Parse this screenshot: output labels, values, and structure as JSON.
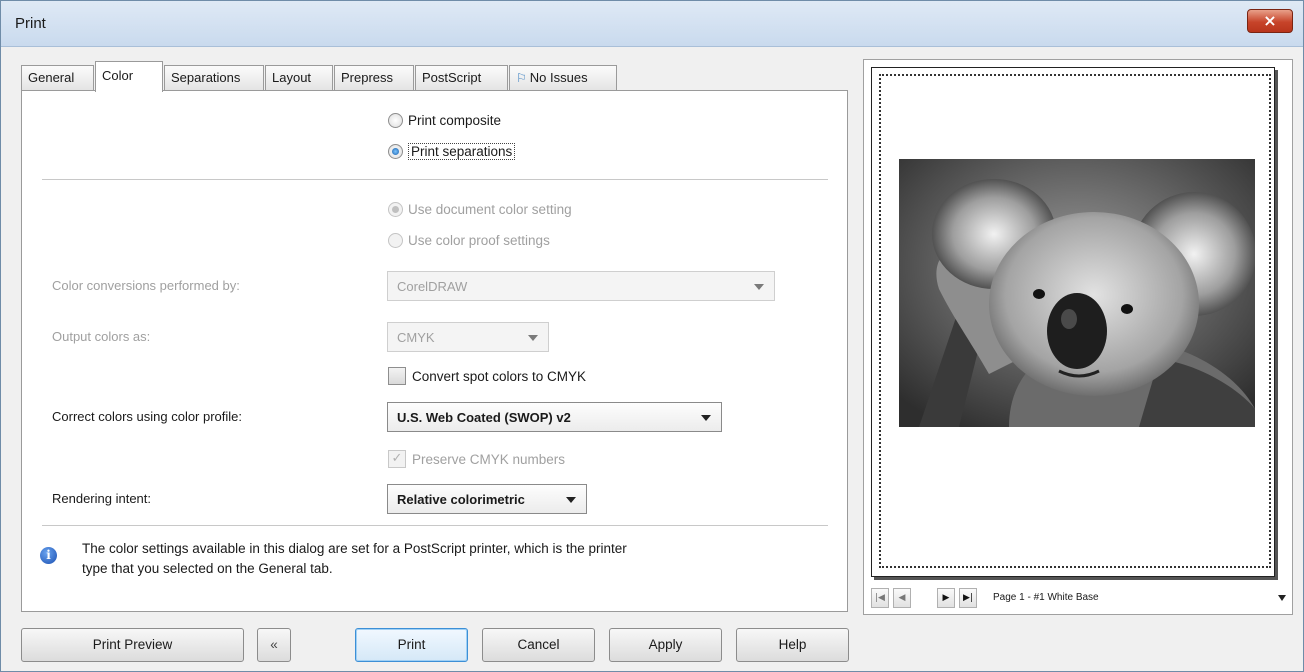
{
  "window": {
    "title": "Print",
    "close_symbol": "×"
  },
  "tabs": [
    {
      "label": "General"
    },
    {
      "label": "Color",
      "active": true
    },
    {
      "label": "Separations"
    },
    {
      "label": "Layout"
    },
    {
      "label": "Prepress"
    },
    {
      "label": "PostScript"
    },
    {
      "label": "No Issues",
      "icon": "issues-icon"
    }
  ],
  "color_tab": {
    "print_composite": "Print composite",
    "print_separations": "Print separations",
    "use_document_color_setting": "Use document color setting",
    "use_color_proof_settings": "Use color proof settings",
    "color_conversions_label": "Color conversions performed by:",
    "color_conversions_value": "CorelDRAW",
    "output_colors_label": "Output colors as:",
    "output_colors_value": "CMYK",
    "convert_spot_label": "Convert spot colors to CMYK",
    "correct_colors_label": "Correct colors using color profile:",
    "correct_colors_value": "U.S. Web Coated (SWOP) v2",
    "preserve_cmyk_label": "Preserve CMYK numbers",
    "rendering_intent_label": "Rendering intent:",
    "rendering_intent_value": "Relative colorimetric",
    "info_line1": "The color settings available in this dialog are set for a PostScript printer, which is the printer",
    "info_line2": "type that you selected on the General tab."
  },
  "buttons": {
    "print_preview": "Print Preview",
    "collapse": "«",
    "print": "Print",
    "cancel": "Cancel",
    "apply": "Apply",
    "help": "Help"
  },
  "preview": {
    "page_label": "Page 1 - #1 White Base",
    "nav_first": "|◀",
    "nav_prev": "◀",
    "nav_next": "▶",
    "nav_last": "▶|"
  }
}
